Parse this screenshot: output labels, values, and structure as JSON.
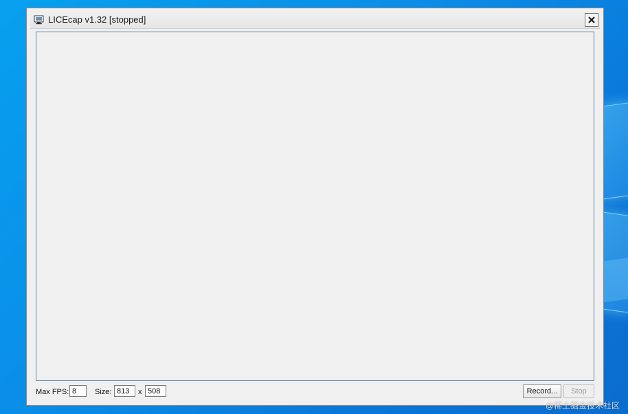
{
  "window": {
    "title": "LICEcap v1.32 [stopped]",
    "icon": "licecap-app-icon",
    "close_icon": "close-icon"
  },
  "controls": {
    "max_fps_label": "Max FPS:",
    "max_fps_value": "8",
    "size_label": "Size:",
    "width_value": "813",
    "size_separator": "x",
    "height_value": "508",
    "record_label": "Record...",
    "stop_label": "Stop"
  },
  "watermark": "@稀土掘金技术社区"
}
